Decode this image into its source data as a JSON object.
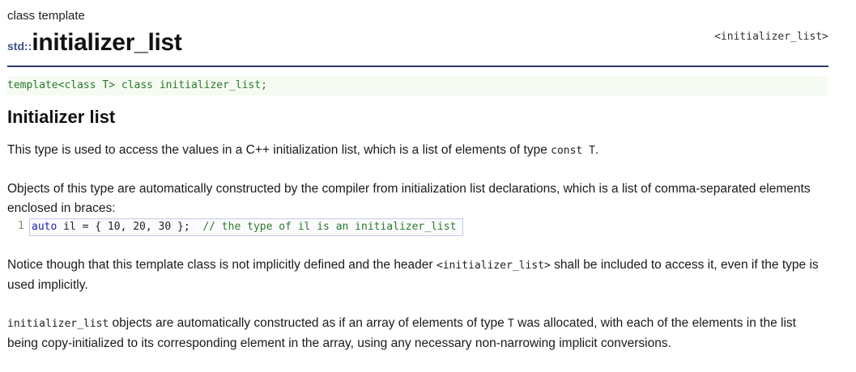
{
  "header": {
    "category": "class template",
    "namespace": "std::",
    "name": "initializer_list",
    "header_file": "<initializer_list>"
  },
  "prototype": "template<class T> class initializer_list;",
  "section": {
    "title": "Initializer list"
  },
  "paragraph1": {
    "text_before": "This type is used to access the values in a C++ initialization list, which is a list of elements of type ",
    "code": "const T",
    "text_after": "."
  },
  "paragraph2": {
    "text": "Objects of this type are automatically constructed by the compiler from initialization list declarations, which is a list of comma-separated elements enclosed in braces:"
  },
  "example": {
    "line_number": "1",
    "keyword": "auto",
    "code": " il = { 10, 20, 30 };  ",
    "comment": "// the type of il is an initializer_list"
  },
  "paragraph3": {
    "text_before": "Notice though that this template class is not implicitly defined and the header ",
    "code": "<initializer_list>",
    "text_after": " shall be included to access it, even if the type is used implicitly."
  },
  "paragraph4": {
    "code_start": "initializer_list",
    "text_before": " objects are automatically constructed as if an array of elements of type ",
    "code_type": "T",
    "text_after": " was allocated, with each of the elements in the list being copy-initialized to its corresponding element in the array, using any necessary non-narrowing implicit conversions."
  }
}
